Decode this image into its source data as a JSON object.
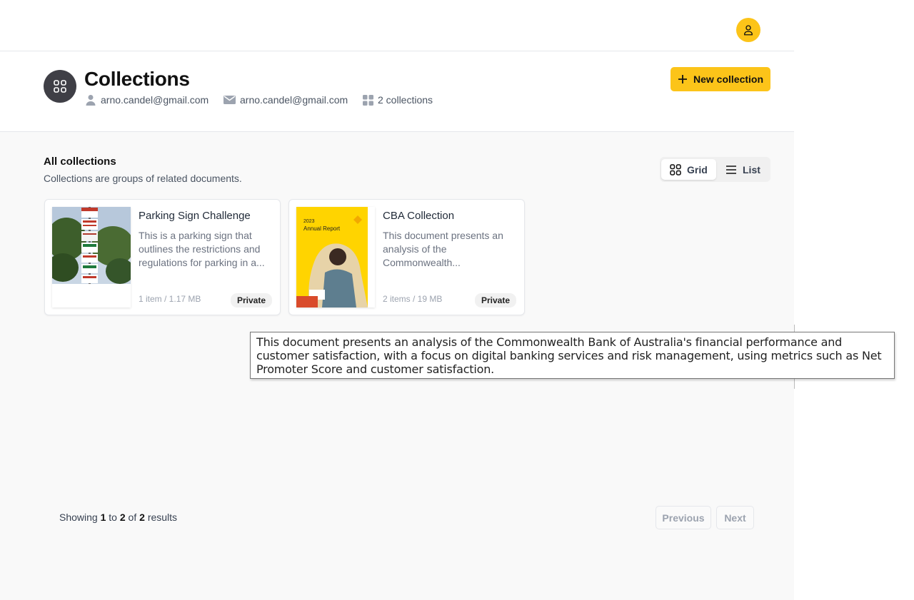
{
  "topbar": {
    "avatar_icon": "user-icon"
  },
  "header": {
    "icon": "grid-icon",
    "title": "Collections",
    "owner": "arno.candel@gmail.com",
    "email": "arno.candel@gmail.com",
    "count": "2 collections",
    "new_button": "New collection"
  },
  "section": {
    "title": "All collections",
    "subtitle": "Collections are groups of related documents.",
    "views": {
      "grid": "Grid",
      "list": "List",
      "active": "grid"
    }
  },
  "cards": [
    {
      "title": "Parking Sign Challenge",
      "description": "This is a parking sign that outlines the restrictions and regulations for parking in a...",
      "meta": "1 item / 1.17 MB",
      "badge": "Private"
    },
    {
      "title": "CBA Collection",
      "description": "This document presents an analysis of the Commonwealth...",
      "meta": "2 items / 19 MB",
      "badge": "Private",
      "thumb_year": "2023",
      "thumb_label": "Annual Report"
    }
  ],
  "tooltip": {
    "text": "This document presents an analysis of the Commonwealth Bank of Australia's financial performance and customer satisfaction, with a focus on digital banking services and risk management, using metrics such as Net Promoter Score and customer satisfaction."
  },
  "pagination": {
    "prefix": "Showing",
    "from": "1",
    "to_word": "to",
    "to": "2",
    "of_word": "of",
    "total": "2",
    "suffix": "results",
    "previous": "Previous",
    "next": "Next"
  },
  "colors": {
    "accent": "#fcc419",
    "page_bg": "#f9f9f9",
    "dark_icon_bg": "#3f3f46"
  }
}
